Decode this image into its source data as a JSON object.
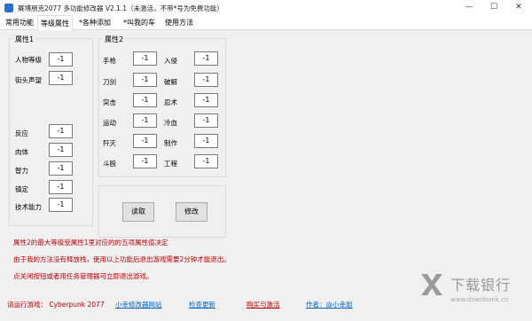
{
  "window": {
    "title": "赛博朋克2077 多功能修改器  V2.1.1（未激活，不带*号为免费功能）",
    "minimize": "—",
    "maximize": "☐",
    "close": "✕"
  },
  "tabs": [
    {
      "label": "常用功能",
      "active": false
    },
    {
      "label": "等级属性",
      "active": true
    },
    {
      "label": "*各种添加",
      "active": false
    },
    {
      "label": "*叫我的车",
      "active": false
    },
    {
      "label": "使用方法",
      "active": false
    }
  ],
  "attributes1": {
    "legend": "属性1",
    "rows": [
      {
        "label": "人物等级",
        "value": "-1"
      },
      {
        "label": "街头声望",
        "value": "-1"
      },
      {
        "label": "反应",
        "value": "-1"
      },
      {
        "label": "肉体",
        "value": "-1"
      },
      {
        "label": "智力",
        "value": "-1"
      },
      {
        "label": "镇定",
        "value": "-1"
      },
      {
        "label": "技术能力",
        "value": "-1"
      }
    ]
  },
  "attributes2": {
    "legend": "属性2",
    "left": [
      {
        "label": "手枪",
        "value": "-1"
      },
      {
        "label": "刀剑",
        "value": "-1"
      },
      {
        "label": "突击",
        "value": "-1"
      },
      {
        "label": "运动",
        "value": "-1"
      },
      {
        "label": "歼灭",
        "value": "-1"
      },
      {
        "label": "斗殴",
        "value": "-1"
      }
    ],
    "right": [
      {
        "label": "入侵",
        "value": "-1"
      },
      {
        "label": "破解",
        "value": "-1"
      },
      {
        "label": "忍术",
        "value": "-1"
      },
      {
        "label": "冷血",
        "value": "-1"
      },
      {
        "label": "制作",
        "value": "-1"
      },
      {
        "label": "工程",
        "value": "-1"
      }
    ]
  },
  "actions": {
    "read": "读取",
    "modify": "修改"
  },
  "info": [
    "属性2的最大等级受属性1里对应的的五项属性值决定",
    "由于我的方法没有释放栈，使用以上功能后退出游戏需要2分钟才能退出。",
    "点关闭按钮或者用任务管理器可立即退出游戏。"
  ],
  "status": {
    "game": "请运行游戏：  Cyberpunk 2077",
    "site": "小幸修改器网站",
    "update": "检查更新",
    "buy": "购买与激活",
    "author": "作者：@小幸姐"
  },
  "watermark": {
    "name": "下载银行",
    "url": "www.downbank.cn"
  },
  "colors": {
    "accent_red": "#c00000",
    "link_blue": "#0066cc",
    "panel_bg": "#f0f0f0"
  }
}
